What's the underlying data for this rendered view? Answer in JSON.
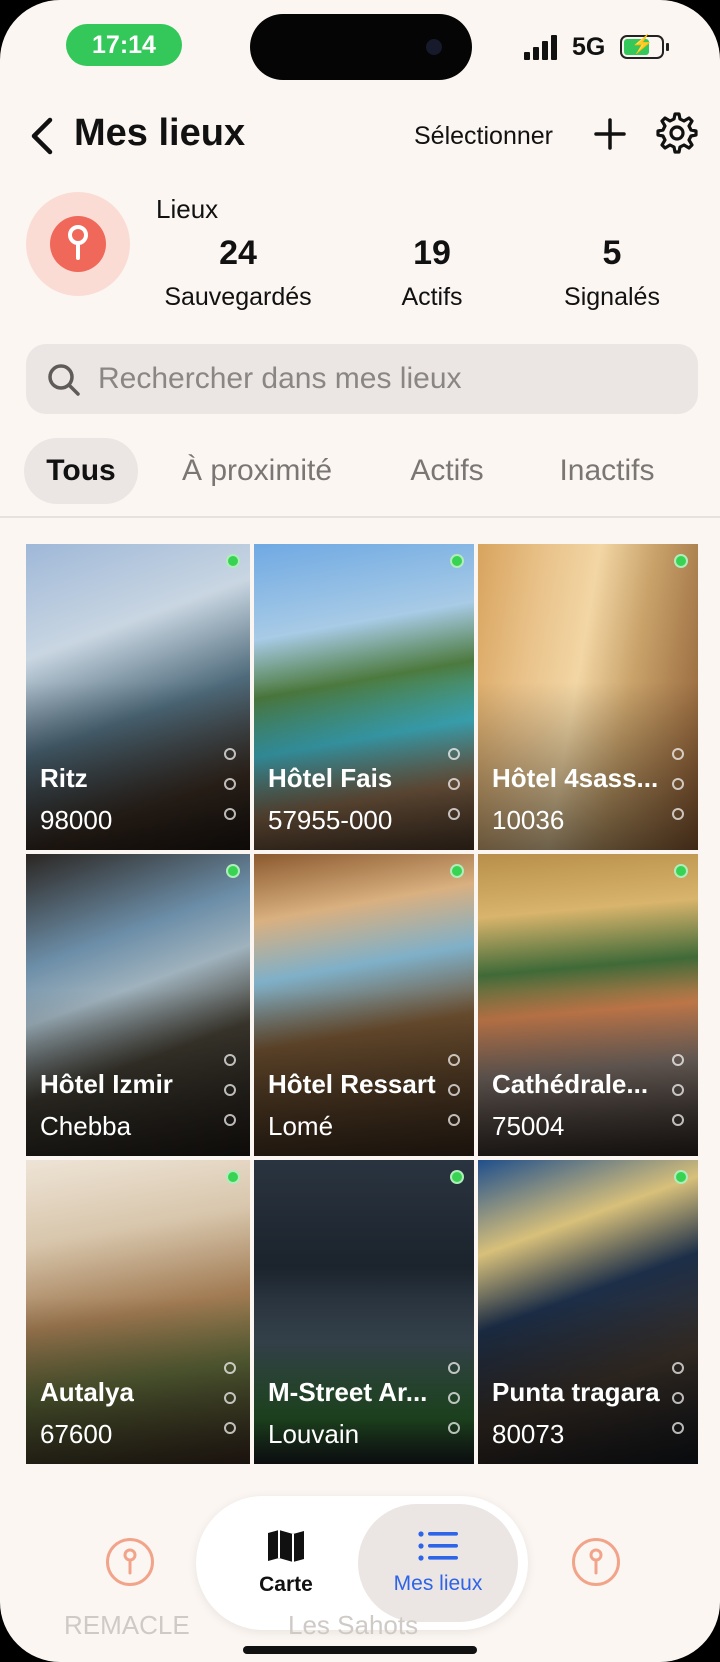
{
  "status_bar": {
    "time": "17:14",
    "network": "5G",
    "battery_color": "#34c759"
  },
  "header": {
    "title": "Mes lieux",
    "select_label": "Sélectionner",
    "back_icon": "chevron-left-icon",
    "add_icon": "plus-icon",
    "settings_icon": "gear-icon"
  },
  "stats": {
    "label": "Lieux",
    "items": [
      {
        "value": "24",
        "label": "Sauvegardés"
      },
      {
        "value": "19",
        "label": "Actifs"
      },
      {
        "value": "5",
        "label": "Signalés"
      }
    ]
  },
  "search": {
    "placeholder": "Rechercher dans mes lieux",
    "value": ""
  },
  "tabs": [
    {
      "label": "Tous",
      "active": true
    },
    {
      "label": "À proximité",
      "active": false
    },
    {
      "label": "Actifs",
      "active": false
    },
    {
      "label": "Inactifs",
      "active": false
    }
  ],
  "places": [
    {
      "name": "Ritz",
      "subtitle": "98000",
      "status": "active"
    },
    {
      "name": "Hôtel Fais",
      "subtitle": "57955-000",
      "status": "active"
    },
    {
      "name": "Hôtel 4sass...",
      "subtitle": "10036",
      "status": "active"
    },
    {
      "name": "Hôtel Izmir",
      "subtitle": "Chebba",
      "status": "active"
    },
    {
      "name": "Hôtel Ressart",
      "subtitle": "Lomé",
      "status": "active"
    },
    {
      "name": "Cathédrale...",
      "subtitle": "75004",
      "status": "active"
    },
    {
      "name": "Autalya",
      "subtitle": "67600",
      "status": "active"
    },
    {
      "name": "M-Street Ar...",
      "subtitle": "Louvain",
      "status": "active"
    },
    {
      "name": "Punta tragara",
      "subtitle": "80073",
      "status": "active"
    }
  ],
  "bottom_nav": {
    "left_label": "REMACLE",
    "center_label": "Les Sahots",
    "segment": [
      {
        "label": "Carte",
        "icon": "map-icon",
        "active": false
      },
      {
        "label": "Mes lieux",
        "icon": "list-icon",
        "active": true
      }
    ]
  },
  "colors": {
    "accent_red": "#f0685a",
    "active_blue": "#2d64e8",
    "status_green": "#39d353"
  }
}
